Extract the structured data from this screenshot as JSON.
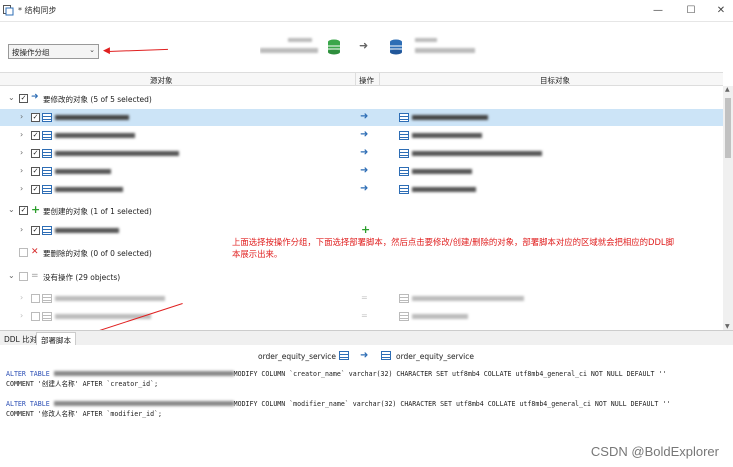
{
  "window": {
    "title": "* 结构同步"
  },
  "toolbar": {
    "group_select": "按操作分组"
  },
  "columns": {
    "source": "源对象",
    "action": "操作",
    "target": "目标对象"
  },
  "groups": {
    "modify": {
      "label": "要修改的对象",
      "count": "(5 of 5 selected)"
    },
    "create": {
      "label": "要创建的对象",
      "count": "(1 of 1 selected)"
    },
    "delete": {
      "label": "要删除的对象",
      "count": "(0 of 0 selected)"
    },
    "none": {
      "label": "没有操作",
      "count": "(29 objects)"
    }
  },
  "annotation": "上面选择按操作分组，下面选择部署脚本，然后点击要修改/创建/删除的对象，部署脚本对应的区域就会把相应的DDL脚本展示出来。",
  "tabs": [
    "DDL 比对",
    "部署脚本"
  ],
  "deploy": {
    "source_table": "order_equity_service",
    "target_table": "order_equity_service"
  },
  "ddl": {
    "line1_a": "ALTER TABLE ",
    "line1_b": "MODIFY COLUMN `creator_name` varchar(32) CHARACTER SET utf8mb4 COLLATE utf8mb4_general_ci NOT NULL DEFAULT ''",
    "line1_c": " COMMENT '创建人名称' AFTER `creator_id`;",
    "line2_a": "ALTER TABLE ",
    "line2_b": "MODIFY COLUMN `modifier_name` varchar(32) CHARACTER SET utf8mb4 COLLATE utf8mb4_general_ci NOT NULL DEFAULT ''",
    "line2_c": " COMMENT '修改人名称' AFTER `modifier_id`;"
  },
  "watermark": "CSDN @BoldExplorer",
  "colors": {
    "accent": "#2d6db5",
    "annotation": "#e02020",
    "selected_row": "#cce4f7",
    "create": "#2a9d2a",
    "delete": "#d62a2a"
  }
}
